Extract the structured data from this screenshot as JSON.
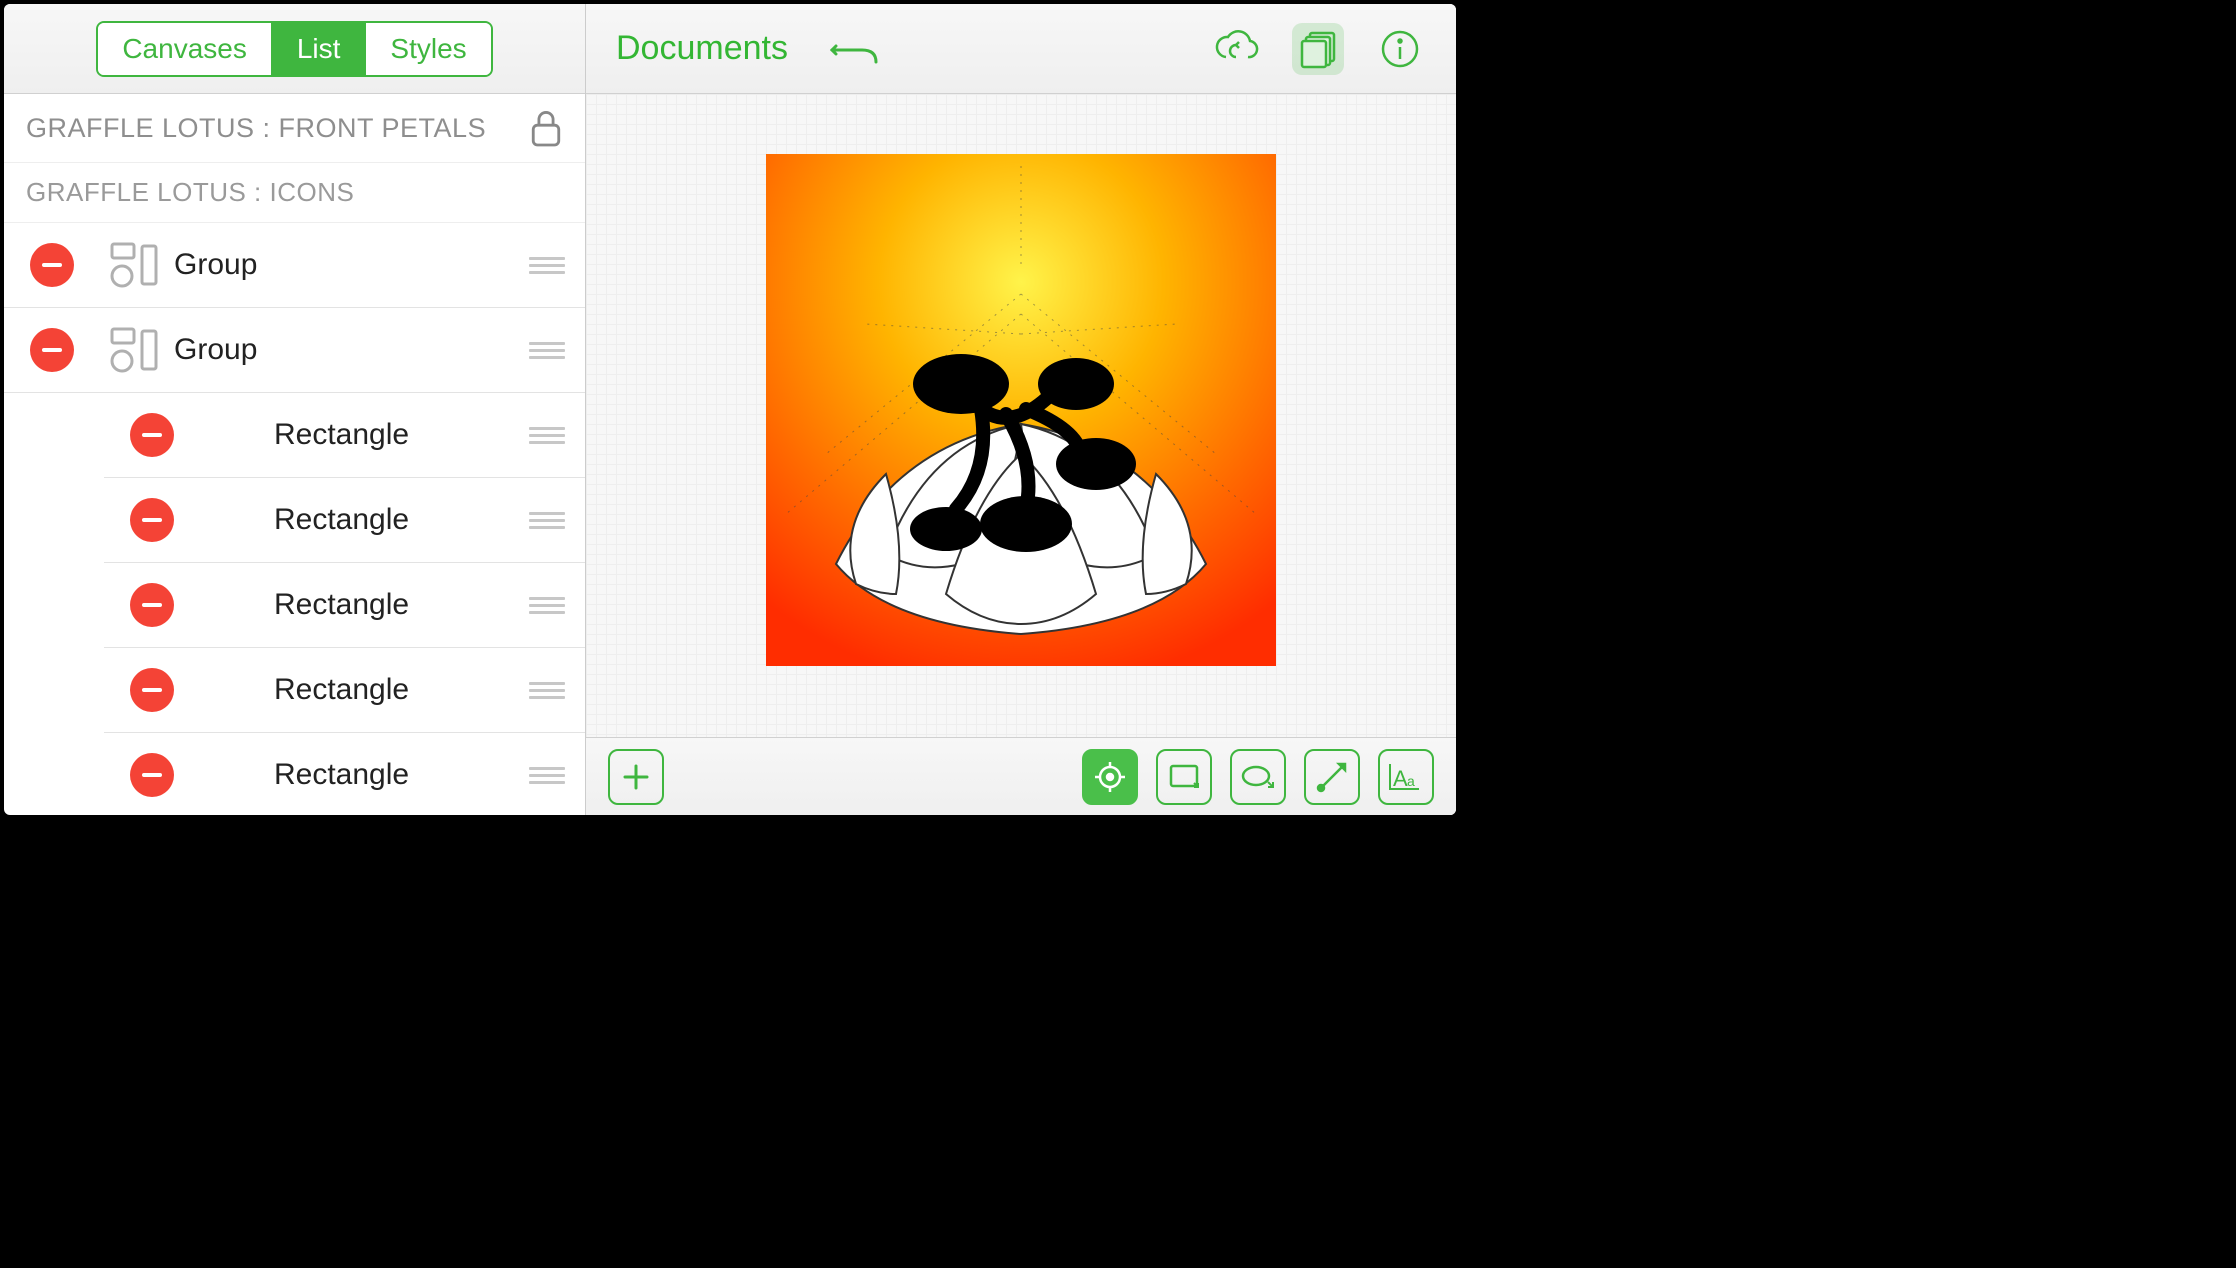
{
  "sidebar": {
    "tabs": [
      "Canvases",
      "List",
      "Styles"
    ],
    "active_tab": 1,
    "layer_headers": [
      "GRAFFLE LOTUS : FRONT PETALS",
      "GRAFFLE LOTUS : ICONS"
    ],
    "items": [
      {
        "label": "Group",
        "type": "group",
        "indent": 0
      },
      {
        "label": "Group",
        "type": "group",
        "indent": 0
      },
      {
        "label": "Rectangle",
        "type": "rect",
        "indent": 1
      },
      {
        "label": "Rectangle",
        "type": "rect",
        "indent": 1
      },
      {
        "label": "Rectangle",
        "type": "rect",
        "indent": 1
      },
      {
        "label": "Rectangle",
        "type": "rect",
        "indent": 1
      },
      {
        "label": "Rectangle",
        "type": "rect",
        "indent": 1
      }
    ]
  },
  "header": {
    "title": "Documents"
  },
  "tools": {
    "add": "add",
    "target": "target",
    "rect": "rectangle",
    "oval": "oval",
    "line": "line",
    "text": "text"
  },
  "colors": {
    "accent": "#3fb63f",
    "delete": "#f44336"
  }
}
